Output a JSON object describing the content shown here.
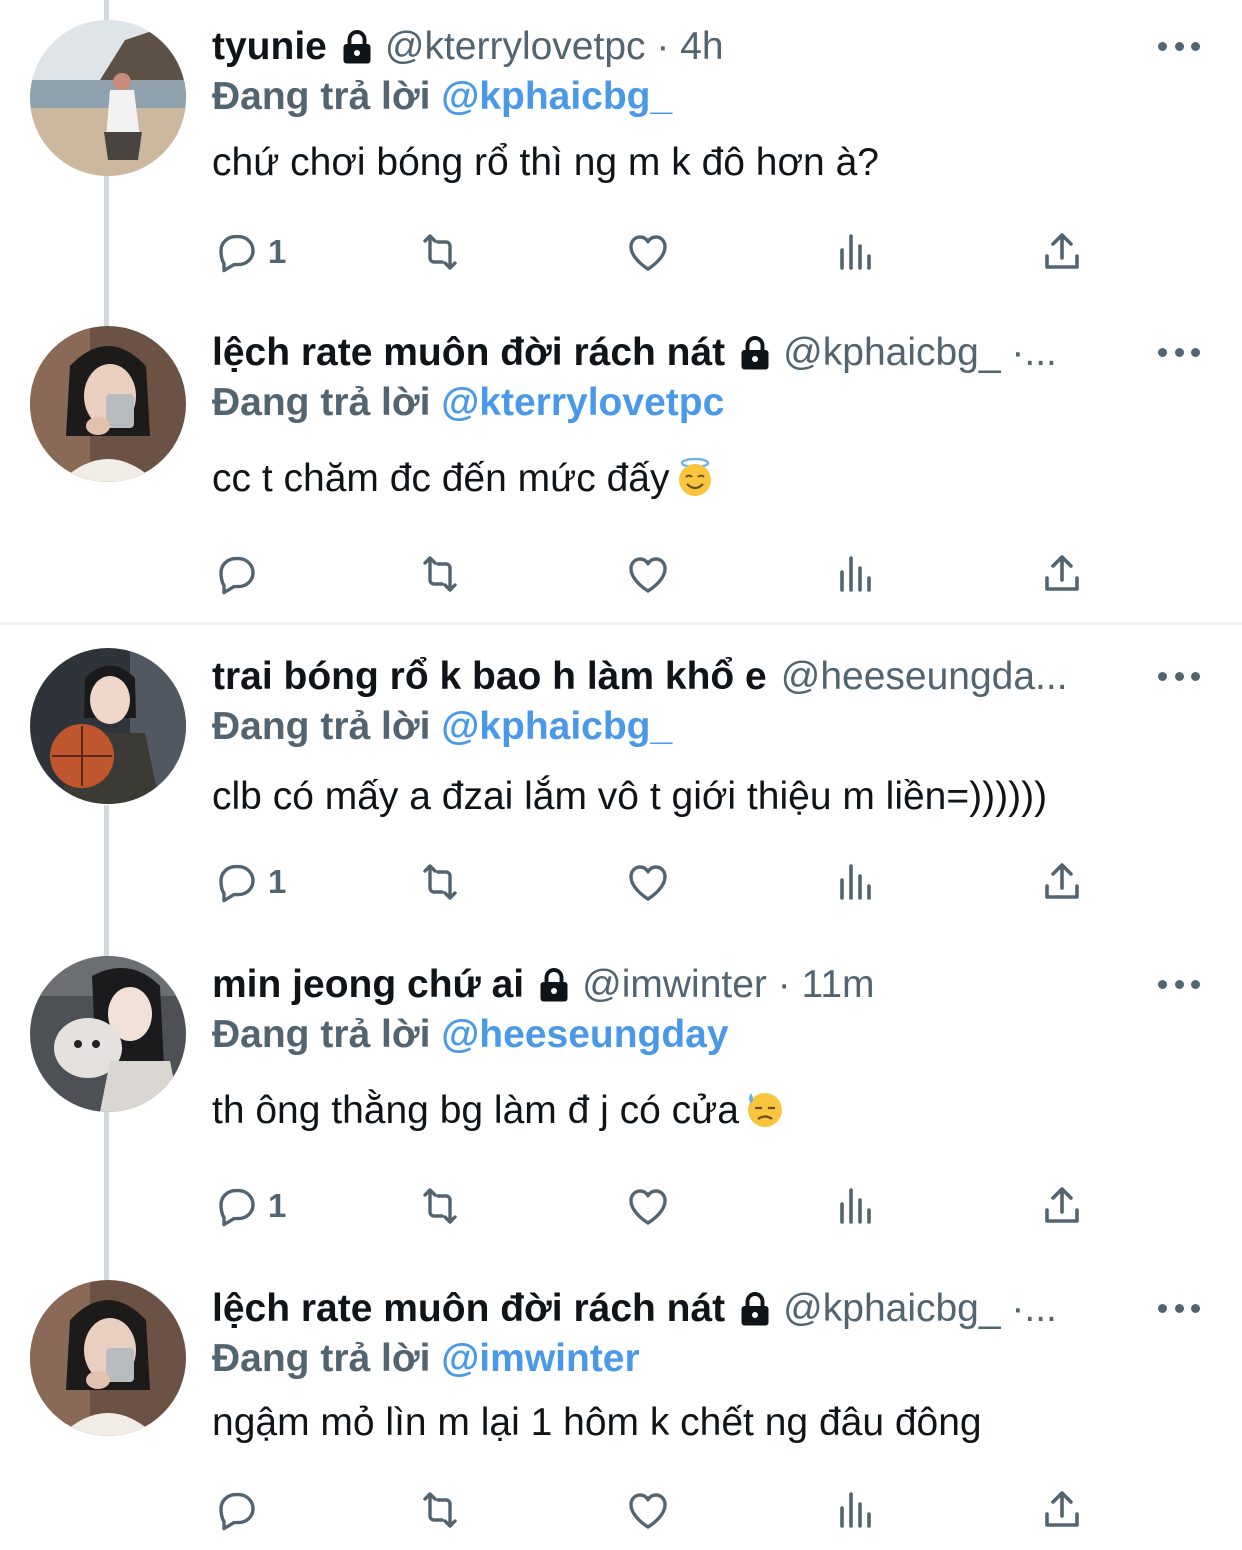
{
  "tweets": [
    {
      "name": "tyunie",
      "handle": "@kterrylovetpc",
      "meta": "@kterrylovetpc · 4h",
      "reply_prefix": "Đang trả lời",
      "reply_to": "@kphaicbg_",
      "text": "chứ chơi bóng rổ thì ng m k đô hơn à?",
      "emoji": "",
      "reply_count": "1",
      "avatar": "beach-photo"
    },
    {
      "name": "lệch rate muôn đời rách nát",
      "handle": "@kphaicbg_",
      "meta": "@kphaicbg_ ·...",
      "reply_prefix": "Đang trả lời",
      "reply_to": "@kterrylovetpc",
      "text": " cc t chăm đc đến mức đấy",
      "emoji": "smiling-face-with-halo",
      "reply_count": "",
      "avatar": "person-with-cup"
    },
    {
      "name": "trai bóng rổ k bao h làm khổ e",
      "handle": "@heeseungda...",
      "meta": "@heeseungda...",
      "reply_prefix": "Đang trả lời",
      "reply_to": "@kphaicbg_",
      "text": "clb có mấy a đzai lắm vô t giới thiệu m liền=))))))",
      "emoji": "",
      "reply_count": "1",
      "avatar": "person-with-basketball"
    },
    {
      "name": "min jeong chứ ai",
      "handle": "@imwinter",
      "meta": "@imwinter · 11m",
      "reply_prefix": "Đang trả lời",
      "reply_to": "@heeseungday",
      "text": "th ông thằng bg làm đ j có cửa",
      "emoji": "downcast-face-with-sweat",
      "reply_count": "1",
      "avatar": "person-with-dog"
    },
    {
      "name": "lệch rate muôn đời rách nát",
      "handle": "@kphaicbg_",
      "meta": "@kphaicbg_ ·...",
      "reply_prefix": "Đang trả lời",
      "reply_to": "@imwinter",
      "text": "ngậm mỏ lìn m lại 1 hôm k chết ng đâu đông",
      "emoji": "",
      "reply_count": "",
      "avatar": "person-with-cup"
    }
  ],
  "icons": {
    "reply": "speech-bubble-icon",
    "retweet": "retweet-icon",
    "like": "heart-icon",
    "views": "bar-chart-icon",
    "share": "share-upload-icon",
    "more": "more-dots-icon",
    "lock": "lock-icon"
  },
  "colors": {
    "text": "#0f1419",
    "secondary": "#536471",
    "link": "#4a99e9",
    "thread_line": "#cfd9de"
  }
}
